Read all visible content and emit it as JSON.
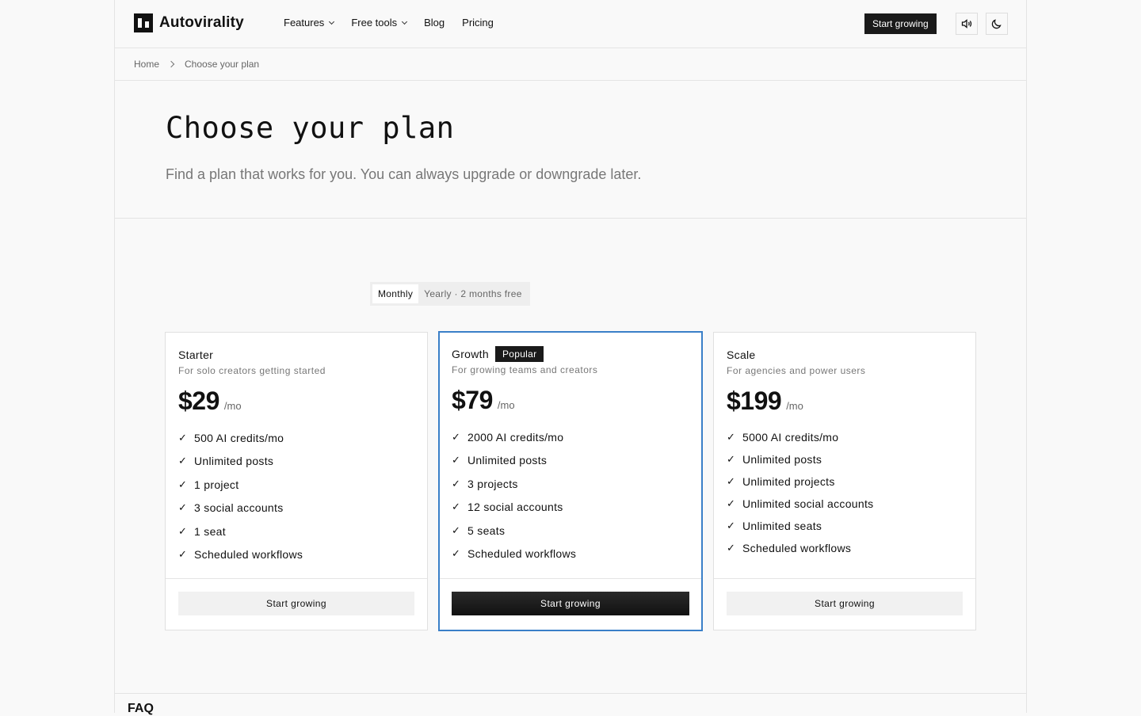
{
  "brand": {
    "name": "Autovirality"
  },
  "nav": {
    "items": [
      {
        "label": "Features",
        "has_menu": true
      },
      {
        "label": "Free tools",
        "has_menu": true
      },
      {
        "label": "Blog",
        "has_menu": false
      },
      {
        "label": "Pricing",
        "has_menu": false
      }
    ]
  },
  "header": {
    "cta_label": "Start growing",
    "sound_icon": "speaker-icon",
    "theme_icon": "moon-icon"
  },
  "breadcrumb": {
    "home": "Home",
    "current": "Choose your plan"
  },
  "hero": {
    "title": "Choose your plan",
    "subtitle": "Find a plan that works for you. You can always upgrade or downgrade later."
  },
  "billing_toggle": {
    "options": [
      "Monthly",
      "Yearly · 2 months free"
    ],
    "selected": "Monthly"
  },
  "plans": [
    {
      "name": "Starter",
      "badge": "",
      "description": "For solo creators getting started",
      "price": "$29",
      "period": "/mo",
      "features": [
        "500 AI credits/mo",
        "Unlimited posts",
        "1 project",
        "3 social accounts",
        "1 seat",
        "Scheduled workflows"
      ],
      "cta": "Start growing"
    },
    {
      "name": "Growth",
      "badge": "Popular",
      "description": "For growing teams and creators",
      "price": "$79",
      "period": "/mo",
      "features": [
        "2000 AI credits/mo",
        "Unlimited posts",
        "3 projects",
        "12 social accounts",
        "5 seats",
        "Scheduled workflows"
      ],
      "cta": "Start growing"
    },
    {
      "name": "Scale",
      "badge": "",
      "description": "For agencies and power users",
      "price": "$199",
      "period": "/mo",
      "features": [
        "5000 AI credits/mo",
        "Unlimited posts",
        "Unlimited projects",
        "Unlimited social accounts",
        "Unlimited seats",
        "Scheduled workflows"
      ],
      "cta": "Start growing"
    }
  ],
  "faq": {
    "title": "FAQ"
  },
  "colors": {
    "accent_border": "#3a7fc8",
    "primary_button": "#1a1a1a",
    "background": "#f9f9f9"
  }
}
